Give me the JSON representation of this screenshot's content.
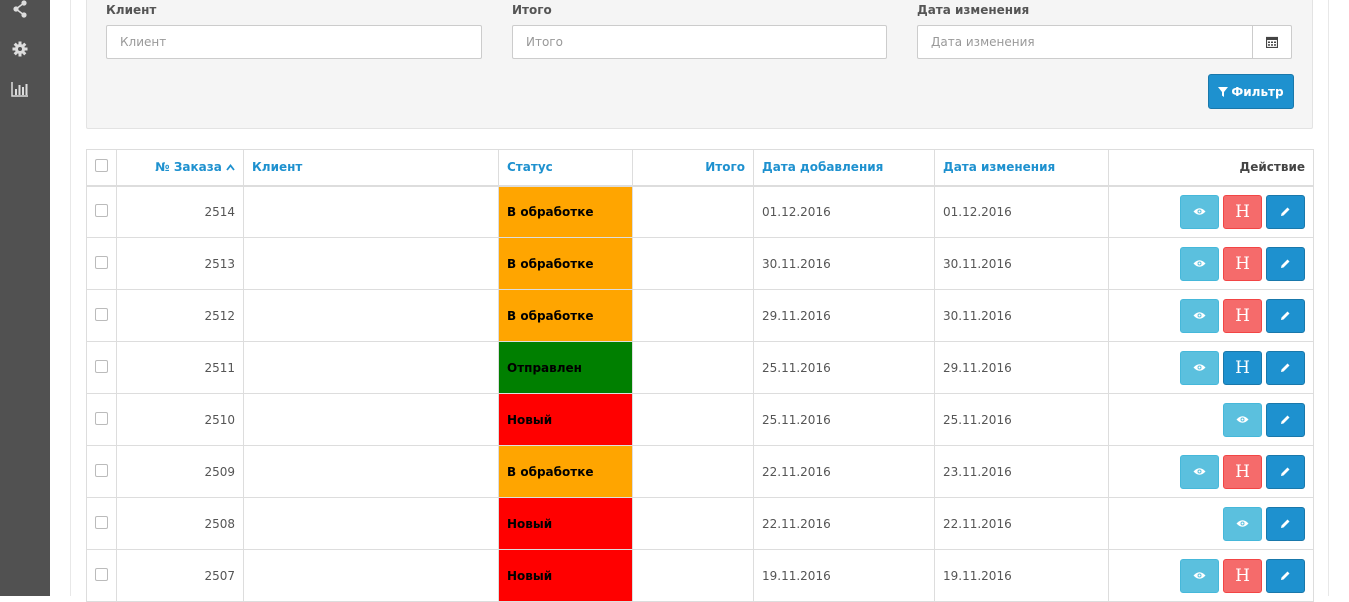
{
  "sidebar": {
    "icons": [
      "share-icon",
      "gear-icon",
      "bar-chart-icon"
    ]
  },
  "filter": {
    "client_label": "Клиент",
    "client_placeholder": "Клиент",
    "total_label": "Итого",
    "total_placeholder": "Итого",
    "modified_label": "Дата изменения",
    "modified_placeholder": "Дата изменения",
    "button_label": "Фильтр",
    "button_icon": "funnel-icon",
    "calendar_icon": "calendar-icon"
  },
  "table": {
    "columns": {
      "order": "№ Заказа",
      "client": "Клиент",
      "status": "Статус",
      "total": "Итого",
      "added": "Дата добавления",
      "modified": "Дата изменения",
      "action": "Действие"
    },
    "sort_indicator": "^",
    "action_h_label": "H",
    "rows": [
      {
        "id": "2514",
        "client": "",
        "status": "В обработке",
        "status_kind": "processing",
        "total": "",
        "added": "01.12.2016",
        "modified": "01.12.2016",
        "h_button": "red"
      },
      {
        "id": "2513",
        "client": "",
        "status": "В обработке",
        "status_kind": "processing",
        "total": "",
        "added": "30.11.2016",
        "modified": "30.11.2016",
        "h_button": "red"
      },
      {
        "id": "2512",
        "client": "",
        "status": "В обработке",
        "status_kind": "processing",
        "total": "",
        "added": "29.11.2016",
        "modified": "30.11.2016",
        "h_button": "red"
      },
      {
        "id": "2511",
        "client": "",
        "status": "Отправлен",
        "status_kind": "sent",
        "total": "",
        "added": "25.11.2016",
        "modified": "29.11.2016",
        "h_button": "blue"
      },
      {
        "id": "2510",
        "client": "",
        "status": "Новый",
        "status_kind": "new",
        "total": "",
        "added": "25.11.2016",
        "modified": "25.11.2016",
        "h_button": "none"
      },
      {
        "id": "2509",
        "client": "",
        "status": "В обработке",
        "status_kind": "processing",
        "total": "",
        "added": "22.11.2016",
        "modified": "23.11.2016",
        "h_button": "red"
      },
      {
        "id": "2508",
        "client": "",
        "status": "Новый",
        "status_kind": "new",
        "total": "",
        "added": "22.11.2016",
        "modified": "22.11.2016",
        "h_button": "none"
      },
      {
        "id": "2507",
        "client": "",
        "status": "Новый",
        "status_kind": "new",
        "total": "",
        "added": "19.11.2016",
        "modified": "19.11.2016",
        "h_button": "red"
      }
    ]
  },
  "colors": {
    "processing": "#ffa500",
    "sent": "#007f00",
    "new": "#ff0000",
    "primary": "#1e91cf",
    "info": "#5bc0de",
    "danger": "#f56b6b",
    "sidebar": "#515151"
  }
}
